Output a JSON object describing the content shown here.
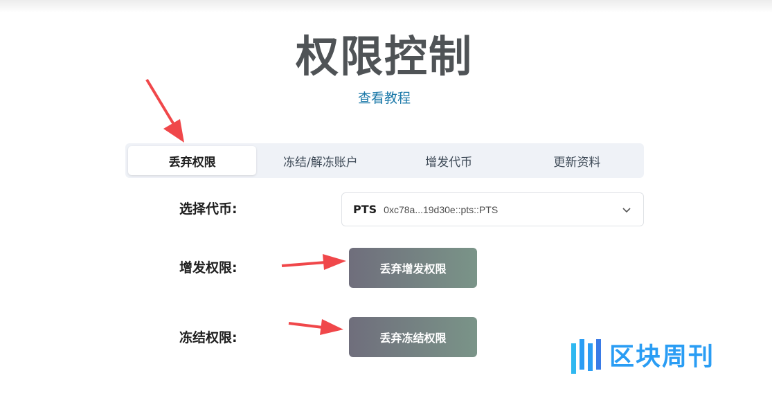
{
  "page": {
    "title": "权限控制",
    "tutorial_link": "查看教程"
  },
  "tabs": [
    {
      "label": "丢弃权限",
      "active": true
    },
    {
      "label": "冻结/解冻账户",
      "active": false
    },
    {
      "label": "增发代币",
      "active": false
    },
    {
      "label": "更新资料",
      "active": false
    }
  ],
  "form": {
    "select_token_label": "选择代币:",
    "token": {
      "symbol": "PTS",
      "address": "0xc78a...19d30e::pts::PTS"
    },
    "mint_label": "增发权限:",
    "mint_button": "丢弃增发权限",
    "freeze_label": "冻结权限:",
    "freeze_button": "丢弃冻结权限"
  },
  "watermark": {
    "text": "区块周刊"
  },
  "colors": {
    "accent_link": "#1a78a8",
    "arrow": "#f0474a",
    "button_start": "#6f6e7c",
    "button_end": "#7a9488",
    "watermark": "#2a9df4"
  }
}
